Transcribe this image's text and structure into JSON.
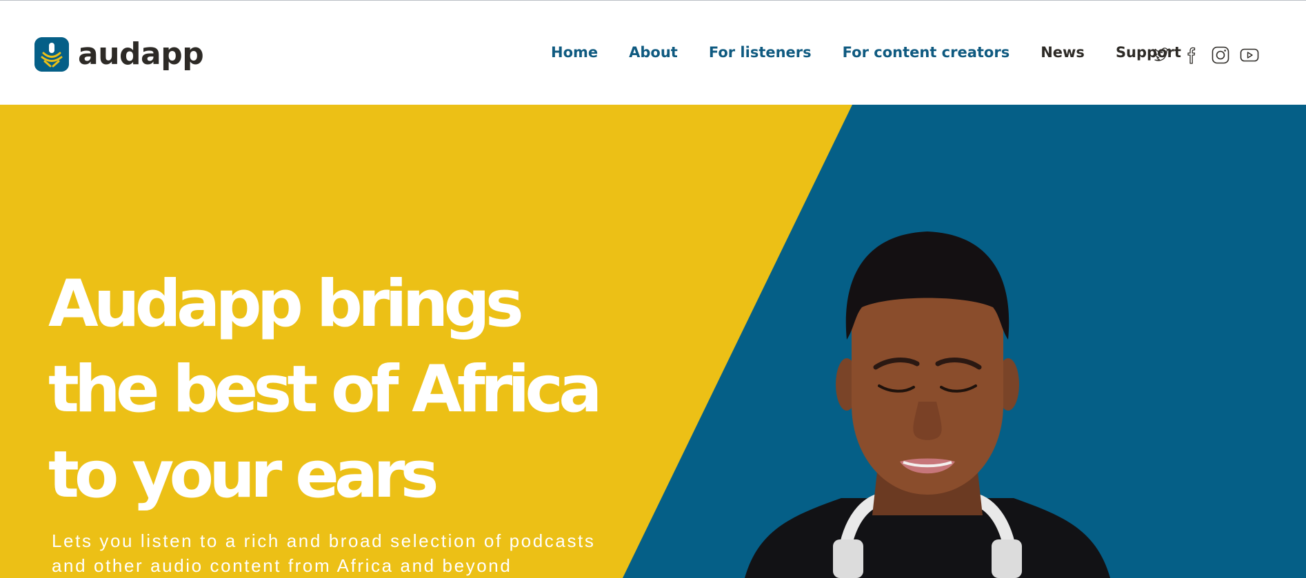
{
  "brand": {
    "name": "audapp",
    "colors": {
      "yellow": "#ecc016",
      "blue": "#055f87",
      "dark": "#2d2a26",
      "nav_blue": "#0f5a80"
    }
  },
  "nav": {
    "items": [
      {
        "label": "Home"
      },
      {
        "label": "About"
      },
      {
        "label": "For listeners"
      },
      {
        "label": "For content creators"
      },
      {
        "label": "News"
      },
      {
        "label": "Support"
      }
    ]
  },
  "social": {
    "icons": [
      "twitter-icon",
      "facebook-icon",
      "instagram-icon",
      "youtube-icon"
    ]
  },
  "hero": {
    "headline": [
      "Audapp brings",
      "the best of Africa",
      "to your ears"
    ],
    "subtext": [
      "Lets you listen to a rich and broad selection of podcasts",
      "and other audio content from Africa and beyond"
    ]
  }
}
